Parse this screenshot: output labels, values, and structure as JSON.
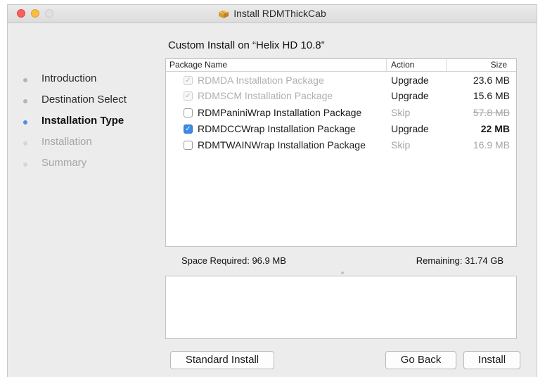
{
  "window": {
    "title": "Install RDMThickCab"
  },
  "sidebar": {
    "steps": [
      {
        "label": "Introduction",
        "state": "done"
      },
      {
        "label": "Destination Select",
        "state": "done"
      },
      {
        "label": "Installation Type",
        "state": "current"
      },
      {
        "label": "Installation",
        "state": "future"
      },
      {
        "label": "Summary",
        "state": "future"
      }
    ]
  },
  "main": {
    "heading": "Custom Install on “Helix HD 10.8”",
    "table": {
      "columns": {
        "name": "Package Name",
        "action": "Action",
        "size": "Size"
      },
      "rows": [
        {
          "name": "RDMDA Installation Package",
          "action": "Upgrade",
          "size": "23.6 MB",
          "checked": true,
          "disabled": true
        },
        {
          "name": "RDMSCM Installation Package",
          "action": "Upgrade",
          "size": "15.6 MB",
          "checked": true,
          "disabled": true
        },
        {
          "name": "RDMPaniniWrap Installation Package",
          "action": "Skip",
          "size": "57.8 MB",
          "checked": false,
          "disabled": false
        },
        {
          "name": "RDMDCCWrap Installation Package",
          "action": "Upgrade",
          "size": "22 MB",
          "checked": true,
          "disabled": false
        },
        {
          "name": "RDMTWAINWrap Installation Package",
          "action": "Skip",
          "size": "16.9 MB",
          "checked": false,
          "disabled": false
        }
      ]
    },
    "space_required": "Space Required:  96.9 MB",
    "remaining": "Remaining:  31.74 GB"
  },
  "buttons": {
    "standard": "Standard Install",
    "back": "Go Back",
    "install": "Install"
  },
  "colors": {
    "accent": "#3b8be6",
    "close": "#fc605c",
    "minimize": "#fdbc40"
  }
}
